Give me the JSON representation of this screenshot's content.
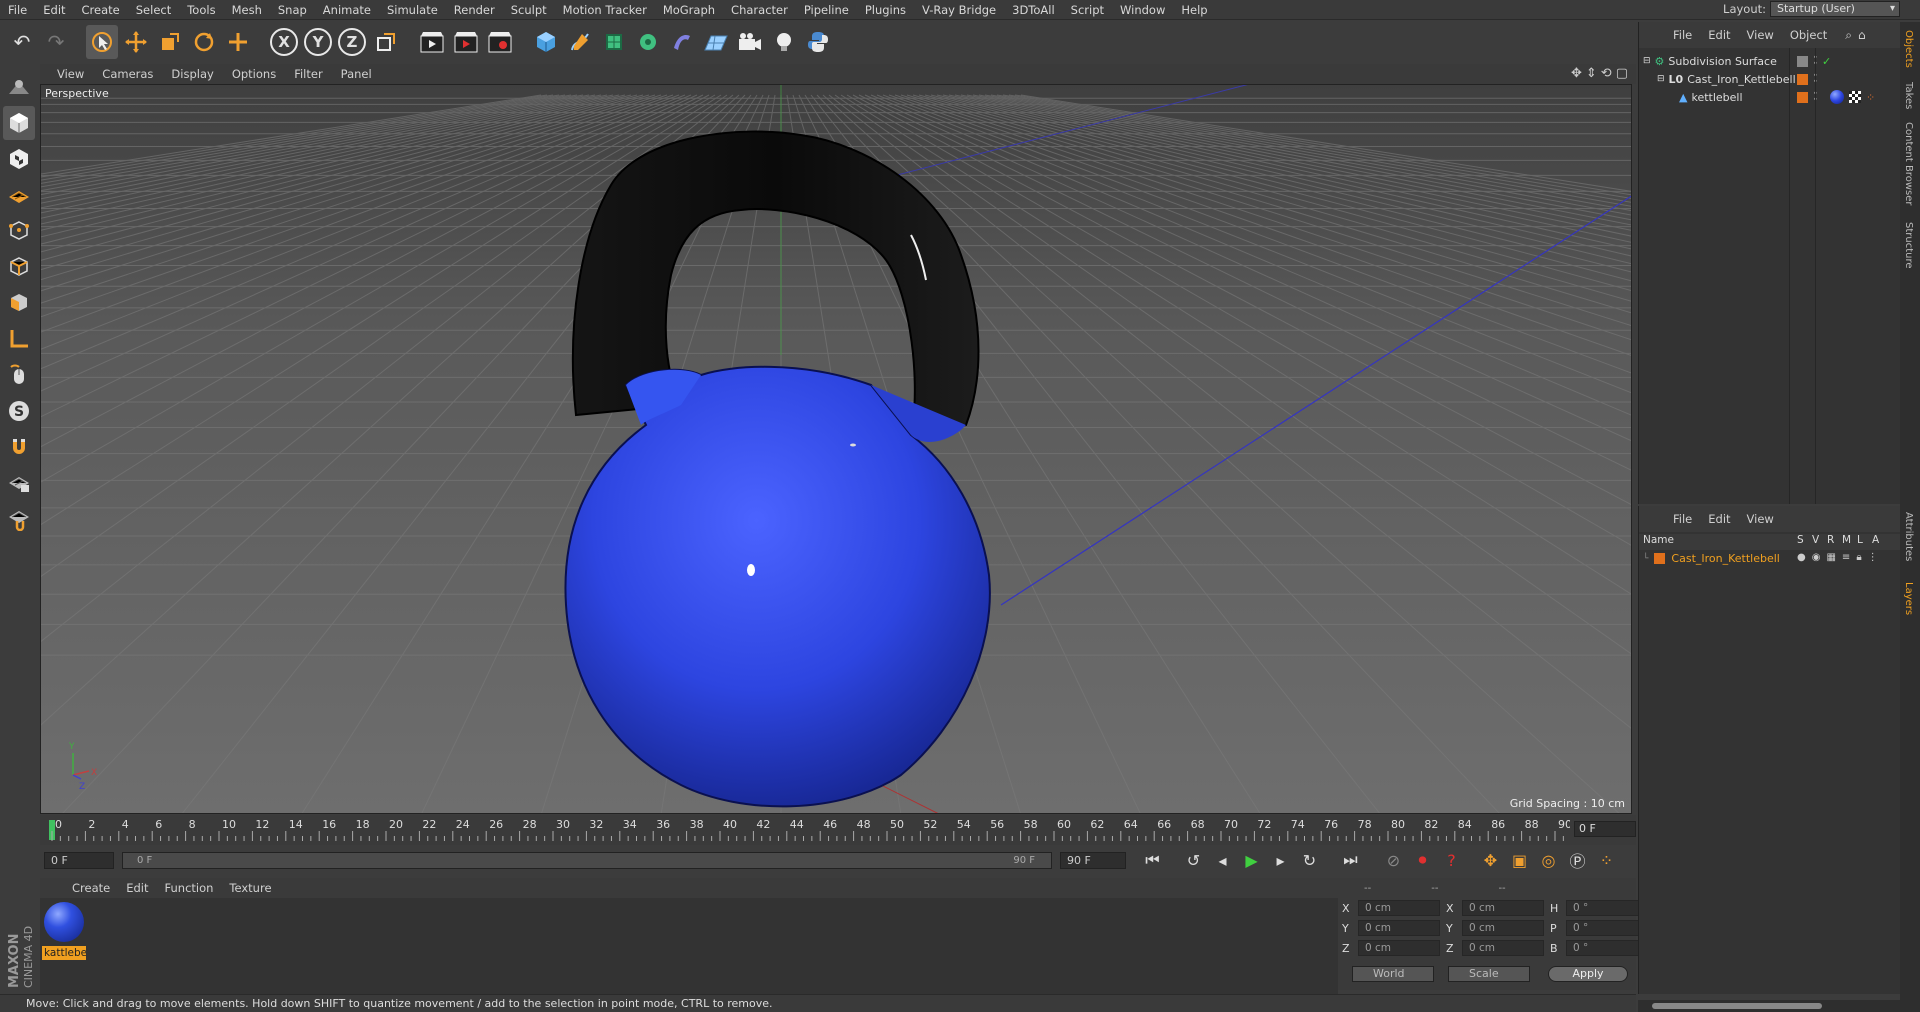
{
  "menubar": {
    "items": [
      "File",
      "Edit",
      "Create",
      "Select",
      "Tools",
      "Mesh",
      "Snap",
      "Animate",
      "Simulate",
      "Render",
      "Sculpt",
      "Motion Tracker",
      "MoGraph",
      "Character",
      "Pipeline",
      "Plugins",
      "V-Ray Bridge",
      "3DToAll",
      "Script",
      "Window",
      "Help"
    ],
    "layout_label": "Layout:",
    "layout_value": "Startup (User)"
  },
  "toolbar": {
    "axis_x": "X",
    "axis_y": "Y",
    "axis_z": "Z"
  },
  "viewport": {
    "menu": [
      "View",
      "Cameras",
      "Display",
      "Options",
      "Filter",
      "Panel"
    ],
    "label": "Perspective",
    "grid_spacing": "Grid Spacing : 10 cm"
  },
  "timeline": {
    "ticks": [
      "0",
      "2",
      "4",
      "6",
      "8",
      "10",
      "12",
      "14",
      "16",
      "18",
      "20",
      "22",
      "24",
      "26",
      "28",
      "30",
      "32",
      "34",
      "36",
      "38",
      "40",
      "42",
      "44",
      "46",
      "48",
      "50",
      "52",
      "54",
      "56",
      "58",
      "60",
      "62",
      "64",
      "66",
      "68",
      "70",
      "72",
      "74",
      "76",
      "78",
      "80",
      "82",
      "84",
      "86",
      "88",
      "90"
    ],
    "current_frame": "0 F",
    "start_field": "0 F",
    "slider_start": "0 F",
    "slider_end": "90 F",
    "end_field": "90 F"
  },
  "material_manager": {
    "menu": [
      "Create",
      "Edit",
      "Function",
      "Texture"
    ],
    "material_name": "kattlebe"
  },
  "coord_manager": {
    "header": [
      "--",
      "--",
      "--"
    ],
    "rows": [
      {
        "l1": "X",
        "v1": "0 cm",
        "l2": "X",
        "v2": "0 cm",
        "l3": "H",
        "v3": "0 °"
      },
      {
        "l1": "Y",
        "v1": "0 cm",
        "l2": "Y",
        "v2": "0 cm",
        "l3": "P",
        "v3": "0 °"
      },
      {
        "l1": "Z",
        "v1": "0 cm",
        "l2": "Z",
        "v2": "0 cm",
        "l3": "B",
        "v3": "0 °"
      }
    ],
    "space": "World",
    "mode": "Scale",
    "apply": "Apply"
  },
  "status": "Move: Click and drag to move elements. Hold down SHIFT to quantize movement / add to the selection in point mode, CTRL to remove.",
  "object_manager": {
    "menu": [
      "File",
      "Edit",
      "View",
      "Object"
    ],
    "objects": [
      {
        "name": "Subdivision Surface"
      },
      {
        "name": "Cast_Iron_Kettlebell"
      },
      {
        "name": "kettlebell"
      }
    ]
  },
  "layer_manager": {
    "menu": [
      "File",
      "Edit",
      "View"
    ],
    "columns": [
      "Name",
      "S",
      "V",
      "R",
      "M",
      "L",
      "A"
    ],
    "layer_name": "Cast_Iron_Kettlebell"
  },
  "side_tabs": [
    "Objects",
    "Takes",
    "Content Browser",
    "Structure",
    "Attributes",
    "Layers"
  ],
  "colors": {
    "accent": "#f0a020",
    "kettlebell_body": "#2d45e0",
    "handle": "#0c0c0c"
  }
}
